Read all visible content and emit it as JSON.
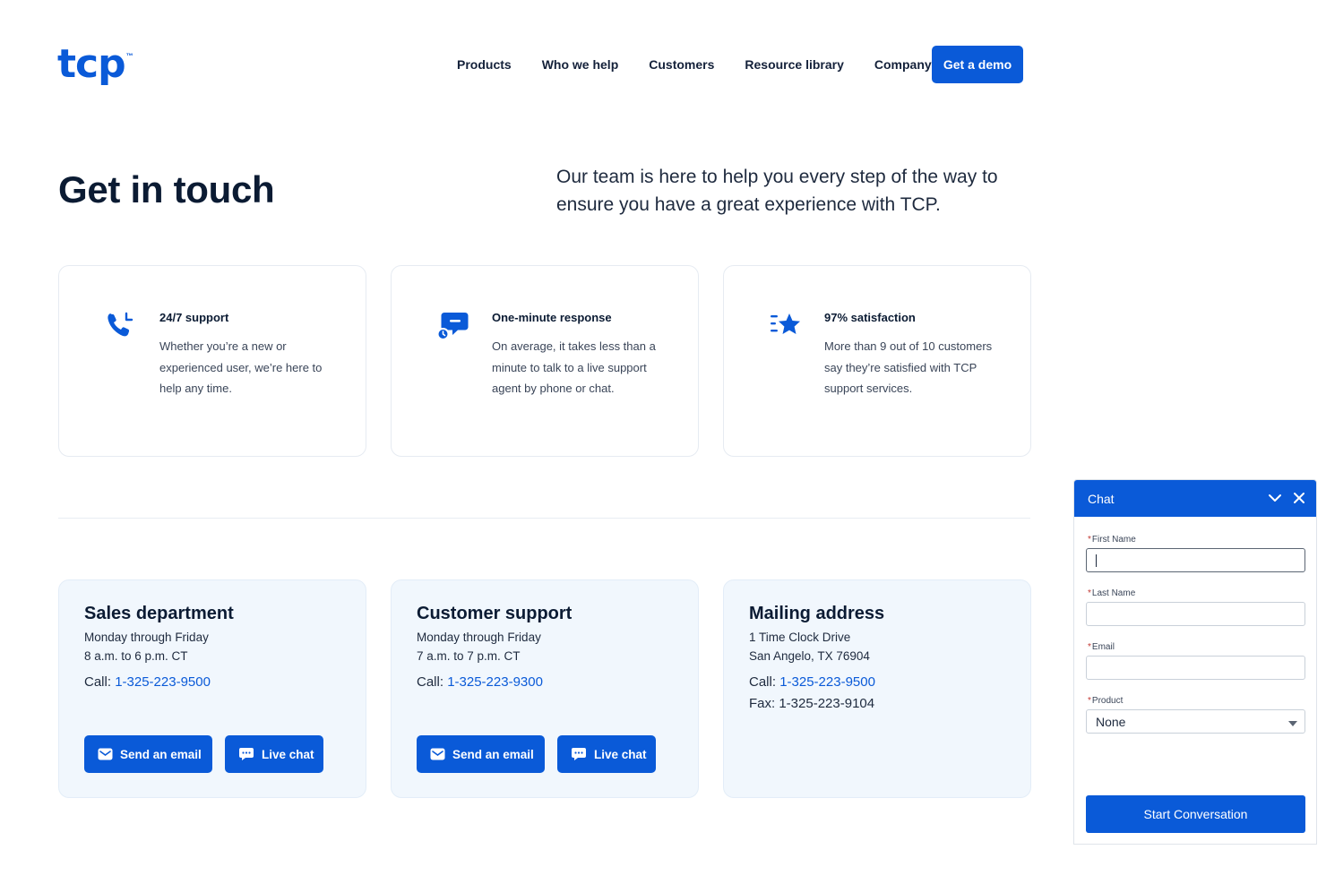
{
  "brand": {
    "logo_text": "tcp",
    "logo_tm": "™",
    "accent_color": "#0a5ad8"
  },
  "nav": {
    "items": [
      {
        "label": "Products"
      },
      {
        "label": "Who we help"
      },
      {
        "label": "Customers"
      },
      {
        "label": "Resource library"
      },
      {
        "label": "Company"
      }
    ],
    "cta_label": "Get a demo"
  },
  "hero": {
    "title": "Get in touch",
    "subtitle": "Our team is here to help you every step of the way to ensure you have a great experience with TCP."
  },
  "features": [
    {
      "icon": "phone-clock-icon",
      "title": "24/7 support",
      "description": "Whether you’re a new or experienced user, we’re here to help any time."
    },
    {
      "icon": "chat-bubble-icon",
      "title": "One-minute response",
      "description": "On average, it takes less than a minute to talk to a live support agent by phone or chat."
    },
    {
      "icon": "star-icon",
      "title": "97% satisfaction",
      "description": "More than 9 out of 10 customers say they’re satisfied with TCP support services."
    }
  ],
  "contacts": [
    {
      "title": "Sales department",
      "line1": "Monday through Friday",
      "line2": "8 a.m. to 6 p.m. CT",
      "call_label": "Call: ",
      "call_number": "1-325-223-9500",
      "email_button": "Send an email",
      "chat_button": "Live chat"
    },
    {
      "title": "Customer support",
      "line1": "Monday through Friday",
      "line2": "7 a.m. to 7 p.m. CT",
      "call_label": "Call: ",
      "call_number": "1-325-223-9300",
      "email_button": "Send an email",
      "chat_button": "Live chat"
    },
    {
      "title": "Mailing address",
      "line1": "1 Time Clock Drive",
      "line2": "San Angelo, TX 76904",
      "call_label": "Call: ",
      "call_number": "1-325-223-9500",
      "fax": "Fax: 1-325-223-9104"
    }
  ],
  "chat": {
    "title": "Chat",
    "required_mark": "*",
    "fields": [
      {
        "label": "First Name",
        "value": ""
      },
      {
        "label": "Last Name",
        "value": ""
      },
      {
        "label": "Email",
        "value": ""
      }
    ],
    "product_label": "Product",
    "product_selected": "None",
    "start_button": "Start Conversation"
  }
}
